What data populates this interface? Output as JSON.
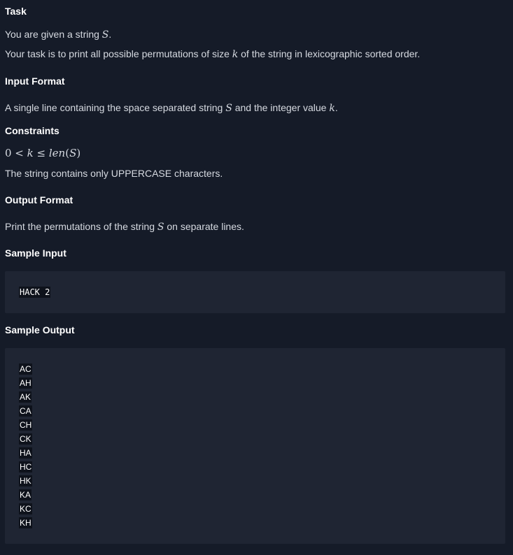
{
  "task": {
    "heading": "Task",
    "line1": {
      "before": "You are given a string ",
      "var": "S",
      "after": "."
    },
    "line2": {
      "before": "Your task is to print all possible permutations of size ",
      "var": "k",
      "after": " of the string in lexicographic sorted order."
    }
  },
  "input_format": {
    "heading": "Input Format",
    "line": {
      "before": "A single line containing the space separated string ",
      "var1": "S",
      "mid": " and the integer value ",
      "var2": "k",
      "after": "."
    }
  },
  "constraints": {
    "heading": "Constraints",
    "math": {
      "a": "0 < ",
      "k": "k",
      "b": " ≤ ",
      "len": "len",
      "c": "(",
      "s": "S",
      "d": ")"
    },
    "line": "The string contains only UPPERCASE characters."
  },
  "output_format": {
    "heading": "Output Format",
    "line": {
      "before": "Print the permutations of the string ",
      "var": "S",
      "after": " on separate lines."
    }
  },
  "sample_input": {
    "heading": "Sample Input",
    "code": "HACK 2"
  },
  "sample_output": {
    "heading": "Sample Output",
    "lines": [
      "AC",
      "AH",
      "AK",
      "CA",
      "CH",
      "CK",
      "HA",
      "HC",
      "HK",
      "KA",
      "KC",
      "KH"
    ]
  }
}
